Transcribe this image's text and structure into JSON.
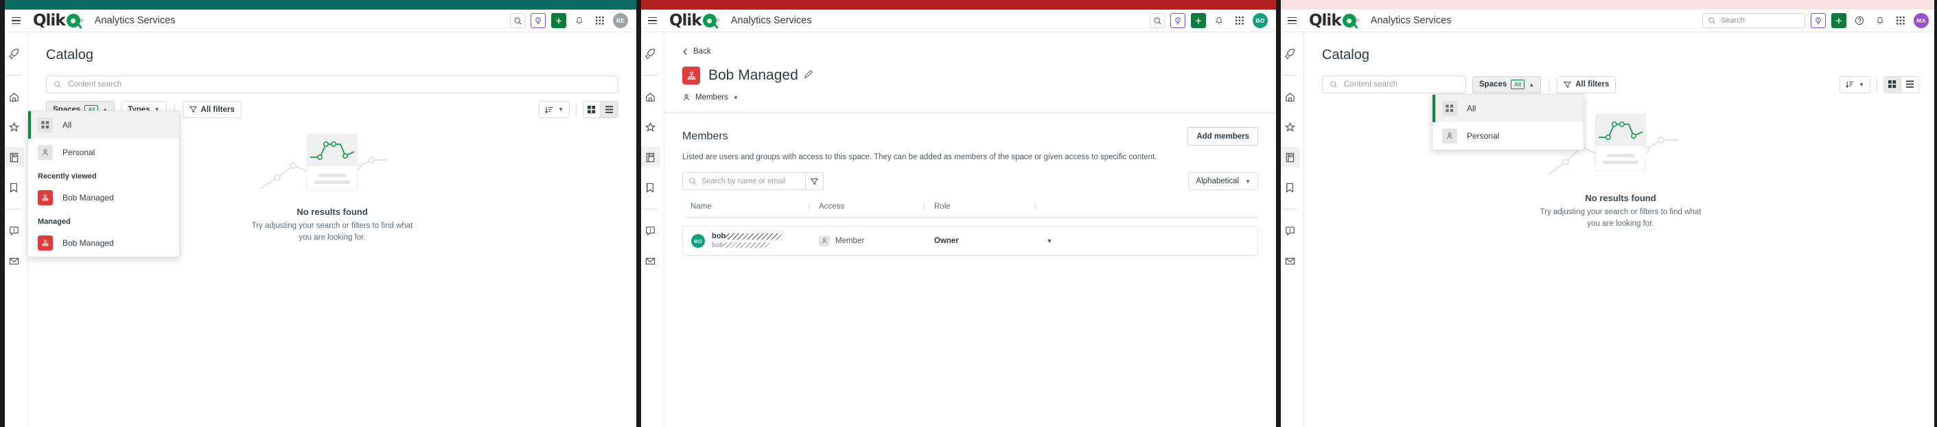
{
  "panels": [
    {
      "id": "panel-left",
      "chrome_color": "#0a6b63",
      "topbar": {
        "brand": "Qlik",
        "app_title": "Analytics Services",
        "avatar_initials": "RE",
        "avatar_color": "#9aa4a6",
        "has_search_field": false,
        "icons": [
          "search-icon",
          "insight-advisor-icon",
          "add-icon",
          "bell-icon",
          "apps-grid-icon"
        ]
      },
      "page": {
        "title": "Catalog",
        "search_placeholder": "Content search",
        "filters": {
          "spaces_label": "Spaces",
          "spaces_badge": "All",
          "types_label": "Types",
          "all_filters_label": "All filters"
        },
        "dropdown_open": true,
        "dropdown": {
          "items": [
            {
              "label": "All",
              "icon": "grid-squares-icon",
              "selected": true,
              "kind": "all"
            },
            {
              "label": "Personal",
              "icon": "person-icon",
              "selected": false,
              "kind": "personal"
            }
          ],
          "groups": [
            {
              "title": "Recently viewed",
              "items": [
                {
                  "label": "Bob Managed",
                  "icon": "managed-space-icon",
                  "color": "#e03c3c"
                }
              ]
            },
            {
              "title": "Managed",
              "items": [
                {
                  "label": "Bob Managed",
                  "icon": "managed-space-icon",
                  "color": "#e03c3c"
                }
              ]
            }
          ]
        },
        "view_mode": "list",
        "empty_state": {
          "title": "No results found",
          "line1": "Try adjusting your search or filters to find what",
          "line2": "you are looking for."
        }
      }
    },
    {
      "id": "panel-middle",
      "chrome_color": "#b32020",
      "topbar": {
        "brand": "Qlik",
        "app_title": "Analytics Services",
        "avatar_initials": "BO",
        "avatar_color": "#12a07e",
        "has_search_field": false,
        "icons": [
          "search-icon",
          "insight-advisor-icon",
          "add-icon",
          "bell-icon",
          "apps-grid-icon"
        ]
      },
      "space": {
        "back_label": "Back",
        "name": "Bob Managed",
        "badge_color": "#e03c3c",
        "tab_label": "Members",
        "members": {
          "heading": "Members",
          "add_button": "Add members",
          "description": "Listed are users and groups with access to this space. They can be added as members of the space or given access to specific content.",
          "search_placeholder": "Search by name or email",
          "sort_label": "Alphabetical",
          "columns": [
            "Name",
            "Access",
            "Role"
          ],
          "rows": [
            {
              "avatar_initials": "BO",
              "avatar_color": "#12a07e",
              "name_prefix": "bob",
              "name_redacted": true,
              "email_prefix": "bob",
              "email_redacted": true,
              "access": "Member",
              "role": "Owner"
            }
          ]
        }
      }
    },
    {
      "id": "panel-right",
      "chrome_color": "#fbdfe2",
      "topbar": {
        "brand": "Qlik",
        "app_title": "Analytics Services",
        "avatar_initials": "MA",
        "avatar_color": "#9b4fd0",
        "has_search_field": true,
        "search_placeholder": "Search",
        "icons": [
          "insight-advisor-icon",
          "add-icon",
          "help-icon",
          "bell-icon",
          "apps-grid-icon"
        ]
      },
      "page": {
        "title": "Catalog",
        "search_placeholder": "Content search",
        "filters": {
          "spaces_label": "Spaces",
          "spaces_badge": "All",
          "all_filters_label": "All filters"
        },
        "dropdown_open": true,
        "dropdown": {
          "items": [
            {
              "label": "All",
              "icon": "grid-squares-icon",
              "selected": true,
              "kind": "all"
            },
            {
              "label": "Personal",
              "icon": "person-icon",
              "selected": false,
              "kind": "personal"
            }
          ],
          "groups": []
        },
        "view_mode": "grid",
        "empty_state": {
          "title": "No results found",
          "line1": "Try adjusting your search or filters to find what",
          "line2": "you are looking for."
        }
      }
    }
  ],
  "rail": {
    "items": [
      {
        "name": "rocket",
        "active": false
      },
      {
        "name": "home",
        "active": false
      },
      {
        "name": "star",
        "active": false
      },
      {
        "name": "catalog",
        "active": true
      },
      {
        "name": "bookmark",
        "active": false
      },
      {
        "name": "alerts",
        "active": false
      },
      {
        "name": "mail",
        "active": false
      }
    ]
  },
  "colors": {
    "qlik_green": "#0a9b4e",
    "accent_green": "#0a8a43",
    "space_red": "#e03c3c"
  }
}
